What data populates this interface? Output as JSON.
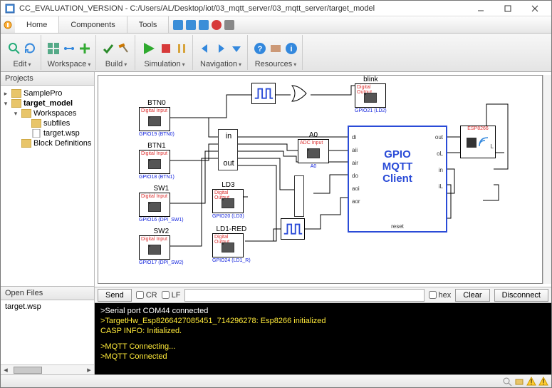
{
  "window": {
    "title": "CC_EVALUATION_VERSION - C:/Users/AL/Desktop/iot/03_mqtt_server/03_mqtt_server/target_model"
  },
  "menu": {
    "tabs": [
      "Home",
      "Components",
      "Tools"
    ]
  },
  "ribbon": {
    "groups": [
      "Edit",
      "Workspace",
      "Build",
      "Simulation",
      "Navigation",
      "Resources"
    ]
  },
  "projects": {
    "header": "Projects",
    "root": "SamplePro",
    "target": "target_model",
    "workspaces": "Workspaces",
    "subfiles": "subfiles",
    "targetwsp": "target.wsp",
    "blockdefs": "Block Definitions"
  },
  "openfiles": {
    "header": "Open Files",
    "items": [
      "target.wsp"
    ]
  },
  "blocks": {
    "blink": {
      "title": "blink",
      "sub": "Digital Output",
      "cap": "GPIO21 (LD2)"
    },
    "btn0": {
      "title": "BTN0",
      "sub": "Digital Input",
      "cap": "GPIO19 (BTN0)"
    },
    "btn1": {
      "title": "BTN1",
      "sub": "Digital Input",
      "cap": "GPIO18 (BTN1)"
    },
    "sw1": {
      "title": "SW1",
      "sub": "Digital Input",
      "cap": "GPIO16 (DPI_SW1)"
    },
    "sw2": {
      "title": "SW2",
      "sub": "Digital Input",
      "cap": "GPIO17 (DPI_SW2)"
    },
    "ld3": {
      "title": "LD3",
      "sub": "Digital Output",
      "cap": "GPIO20 (LD3)"
    },
    "ld1": {
      "title": "LD1-RED",
      "sub": "Digital Output",
      "cap": "GPIO24 (LD1_R)"
    },
    "a0": {
      "title": "A0",
      "sub": "ADC Input",
      "cap": "A0"
    },
    "esp": "ESP8266",
    "main": {
      "l1": "GPIO",
      "l2": "MQTT",
      "l3": "Client"
    },
    "pins": {
      "di": "di",
      "aii": "aii",
      "air": "air",
      "do": "do",
      "aoi": "aoi",
      "aor": "aor",
      "out": "out",
      "oL": "oL",
      "in": "in",
      "iL": "iL",
      "reset": "reset",
      "L": "L"
    }
  },
  "sendrow": {
    "send": "Send",
    "cr": "CR",
    "lf": "LF",
    "hex": "hex",
    "clear": "Clear",
    "disconnect": "Disconnect"
  },
  "console": {
    "l1": ">Serial port COM44 connected",
    "l2": ">TargetHw_Esp8266427085451_714296278: Esp8266 initialized",
    "l3": "CASP INFO: Initialized.",
    "l4": ">MQTT Connecting...",
    "l5": ">MQTT Connected"
  }
}
